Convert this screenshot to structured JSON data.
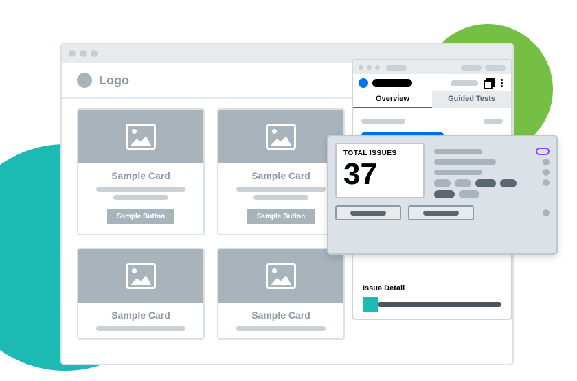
{
  "header": {
    "logo_text": "Logo"
  },
  "cards": [
    {
      "title": "Sample Card",
      "button_label": "Sample Button"
    },
    {
      "title": "Sample Card",
      "button_label": "Sample Button"
    },
    {
      "title": "Sample Card"
    },
    {
      "title": "Sample Card"
    }
  ],
  "extension": {
    "tabs": {
      "overview": "Overview",
      "guided": "Guided Tests"
    },
    "issue_detail_label": "Issue Detail"
  },
  "results": {
    "total_issues_label": "TOTAL ISSUES",
    "total_issues_count": "37"
  }
}
